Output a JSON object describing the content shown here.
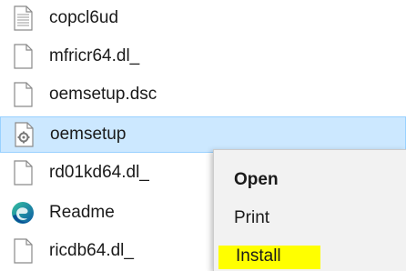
{
  "files": [
    {
      "name": "copcl6ud",
      "icon": "text-file-icon"
    },
    {
      "name": "mfricr64.dl_",
      "icon": "blank-file-icon"
    },
    {
      "name": "oemsetup.dsc",
      "icon": "blank-file-icon"
    },
    {
      "name": "oemsetup",
      "icon": "setup-info-file-icon"
    },
    {
      "name": "rd01kd64.dl_",
      "icon": "blank-file-icon"
    },
    {
      "name": "Readme",
      "icon": "edge-browser-icon"
    },
    {
      "name": "ricdb64.dl_",
      "icon": "blank-file-icon"
    }
  ],
  "selected_file": "oemsetup",
  "context_menu": {
    "items": [
      {
        "label": "Open",
        "bold": true
      },
      {
        "label": "Print",
        "bold": false
      },
      {
        "label": "Install",
        "highlighted": true
      }
    ]
  },
  "colors": {
    "selection_bg": "#cce8ff",
    "selection_border": "#99d1ff",
    "menu_bg": "#f2f2f2",
    "highlight": "#ffff00",
    "edge_blue": "#0c59a4",
    "edge_green": "#35c1a0"
  }
}
